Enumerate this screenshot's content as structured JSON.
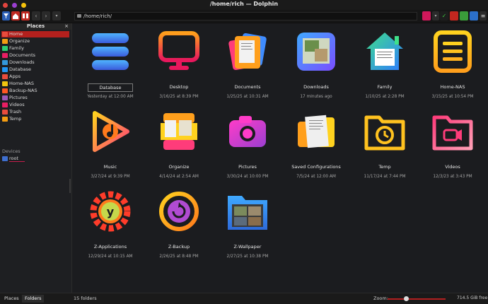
{
  "window": {
    "title": "/home/rich — Dolphin"
  },
  "toolbar": {
    "path": "/home/rich/",
    "back_label": "‹",
    "forward_label": "›",
    "buttons": [
      "filter-icon",
      "places-icon",
      "split-icon",
      "menu-icon"
    ]
  },
  "sidebar": {
    "header": "Places",
    "items": [
      {
        "label": "Home",
        "color": "#e84c3d",
        "icon": "home-icon"
      },
      {
        "label": "Organize",
        "color": "#f39c12",
        "icon": "organize-icon"
      },
      {
        "label": "Family",
        "color": "#2ecc71",
        "icon": "family-icon"
      },
      {
        "label": "Documents",
        "color": "#e91e63",
        "icon": "documents-icon"
      },
      {
        "label": "Downloads",
        "color": "#3498db",
        "icon": "downloads-icon"
      },
      {
        "label": "Database",
        "color": "#2196f3",
        "icon": "database-icon"
      },
      {
        "label": "Apps",
        "color": "#e74c3c",
        "icon": "apps-icon"
      },
      {
        "label": "Home-NAS",
        "color": "#f1c40f",
        "icon": "nas-icon"
      },
      {
        "label": "Backup-NAS",
        "color": "#ff5722",
        "icon": "backup-nas-icon"
      },
      {
        "label": "Pictures",
        "color": "#9b59b6",
        "icon": "pictures-icon"
      },
      {
        "label": "Videos",
        "color": "#e91e63",
        "icon": "videos-icon"
      },
      {
        "label": "Trash",
        "color": "#e84c3d",
        "icon": "trash-icon"
      },
      {
        "label": "Temp",
        "color": "#f39c12",
        "icon": "temp-icon"
      }
    ],
    "devices_header": "Devices",
    "devices": [
      {
        "label": "root",
        "color": "#3f6fcf",
        "icon": "drive-icon"
      }
    ]
  },
  "files": [
    {
      "name": "Database",
      "date": "Yesterday at 12:00 AM",
      "icon": "database-icon"
    },
    {
      "name": "Desktop",
      "date": "3/16/25 at 8:39 PM",
      "icon": "desktop-icon"
    },
    {
      "name": "Documents",
      "date": "1/25/25 at 10:31 AM",
      "icon": "documents-folder-icon"
    },
    {
      "name": "Downloads",
      "date": "17 minutes ago",
      "icon": "downloads-folder-icon"
    },
    {
      "name": "Family",
      "date": "1/10/25 at 2:28 PM",
      "icon": "family-house-icon"
    },
    {
      "name": "Home-NAS",
      "date": "3/15/25 at 10:54 PM",
      "icon": "nas-list-icon"
    },
    {
      "name": "Music",
      "date": "3/27/24 at 9:39 PM",
      "icon": "music-play-icon"
    },
    {
      "name": "Organize",
      "date": "4/14/24 at 2:54 AM",
      "icon": "organize-tray-icon"
    },
    {
      "name": "Pictures",
      "date": "3/30/24 at 10:00 PM",
      "icon": "camera-icon"
    },
    {
      "name": "Saved Configurations",
      "date": "7/5/24 at 12:00 AM",
      "icon": "saved-configurations-icon"
    },
    {
      "name": "Temp",
      "date": "11/17/24 at 7:44 PM",
      "icon": "temp-clock-folder-icon"
    },
    {
      "name": "Videos",
      "date": "12/3/23 at 3:43 PM",
      "icon": "video-folder-icon"
    },
    {
      "name": "Z-Applications",
      "date": "12/29/24 at 10:15 AM",
      "icon": "gear-apps-icon"
    },
    {
      "name": "Z-Backup",
      "date": "2/26/25 at 8:48 PM",
      "icon": "backup-circle-icon"
    },
    {
      "name": "Z-Wallpaper",
      "date": "2/27/25 at 10:38 PM",
      "icon": "wallpaper-folder-icon"
    }
  ],
  "statusbar": {
    "tab_places": "Places",
    "tab_folders": "Folders",
    "status": "15 folders",
    "zoom_label": "Zoom:",
    "free_space": "714.5 GiB free",
    "zoom_level": 0.32
  },
  "colors": {
    "accent": "#b3201d",
    "background": "#1b1c1f"
  }
}
